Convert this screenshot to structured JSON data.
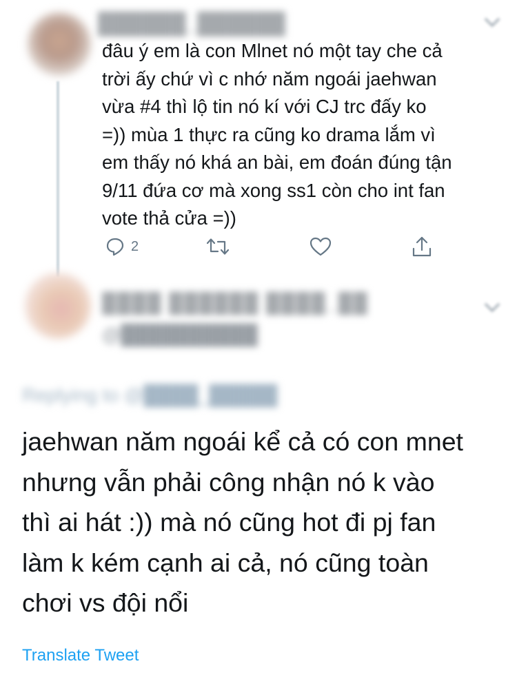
{
  "tweets": [
    {
      "author_name": "██████_██████",
      "text": "đâu ý em là con Mlnet nó một tay che cả\ntrời ấy chứ vì c nhớ năm ngoái jaehwan\nvừa #4 thì lộ tin nó kí với CJ trc đấy ko\n=)) mùa 1 thực ra cũng ko drama lắm vì\nem thấy nó khá an bài, em đoán đúng tận\n9/11 đứa cơ mà xong ss1 còn cho int fan\nvote thả cửa =))",
      "reply_count": "2",
      "actions": [
        "reply-icon",
        "retweet-icon",
        "like-icon",
        "share-icon"
      ]
    },
    {
      "author_name": "████ ██████ ████_██",
      "author_handle": "@██████████",
      "replying_to": "Replying to @████_█████",
      "text": "jaehwan năm ngoái kể cả có con mnet\nnhưng vẫn phải công nhận nó k vào\nthì ai hát :)) mà nó cũng hot đi pj fan\nlàm k kém cạnh ai cả, nó cũng toàn\nchơi vs đội nổi",
      "translate_label": "Translate Tweet"
    }
  ],
  "colors": {
    "text": "#14171a",
    "secondary": "#657786",
    "link": "#1da1f2",
    "divider": "#ccd6dd"
  }
}
